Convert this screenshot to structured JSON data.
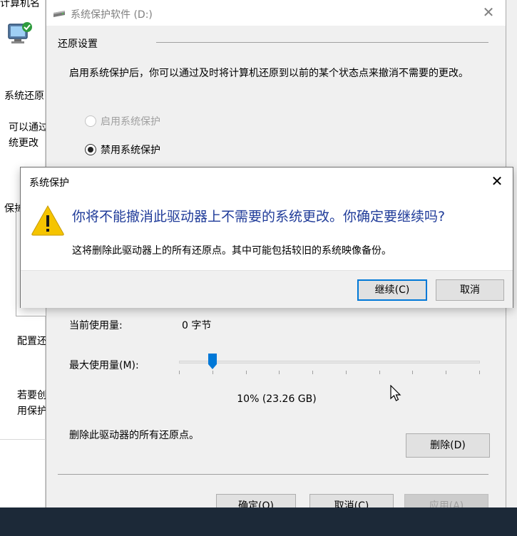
{
  "background_window": {
    "title_fragment": "计算机名",
    "group1_fragment": "系统还原",
    "line1_fragment": "可以通过",
    "line2_fragment": "统更改",
    "group2_fragment": "保护设置",
    "config_fragment": "配置还原",
    "create_line1_fragment": "若要创",
    "create_line2_fragment": "用保护"
  },
  "protection_dialog": {
    "title": "系统保护软件 (D:)",
    "restore_heading": "还原设置",
    "description": "启用系统保护后，你可以通过及时将计算机还原到以前的某个状态点来撤消不需要的更改。",
    "radio_enable": "启用系统保护",
    "radio_disable": "禁用系统保护",
    "current_usage_label": "当前使用量:",
    "current_usage_value": "0 字节",
    "max_usage_label": "最大使用量(M):",
    "max_usage_percent": 10,
    "max_usage_text": "10% (23.26 GB)",
    "delete_label": "删除此驱动器的所有还原点。",
    "delete_button": "删除(D)",
    "ok_button": "确定(O)",
    "cancel_button": "取消(C)",
    "apply_button": "应用(A)"
  },
  "confirm_dialog": {
    "title": "系统保护",
    "main_instruction": "你将不能撤消此驱动器上不需要的系统更改。你确定要继续吗?",
    "detail": "这将删除此驱动器上的所有还原点。其中可能包括较旧的系统映像备份。",
    "continue_button": "继续(C)",
    "cancel_button": "取消"
  },
  "colors": {
    "main_instruction": "#1f3b99",
    "slider_thumb": "#0078d7",
    "warning_fill": "#f5c400",
    "taskbar": "#1c2938"
  },
  "icons": {
    "close": "close-icon",
    "warning": "warning-icon",
    "drive": "drive-icon",
    "computer": "computer-icon",
    "cursor": "mouse-cursor-icon"
  }
}
